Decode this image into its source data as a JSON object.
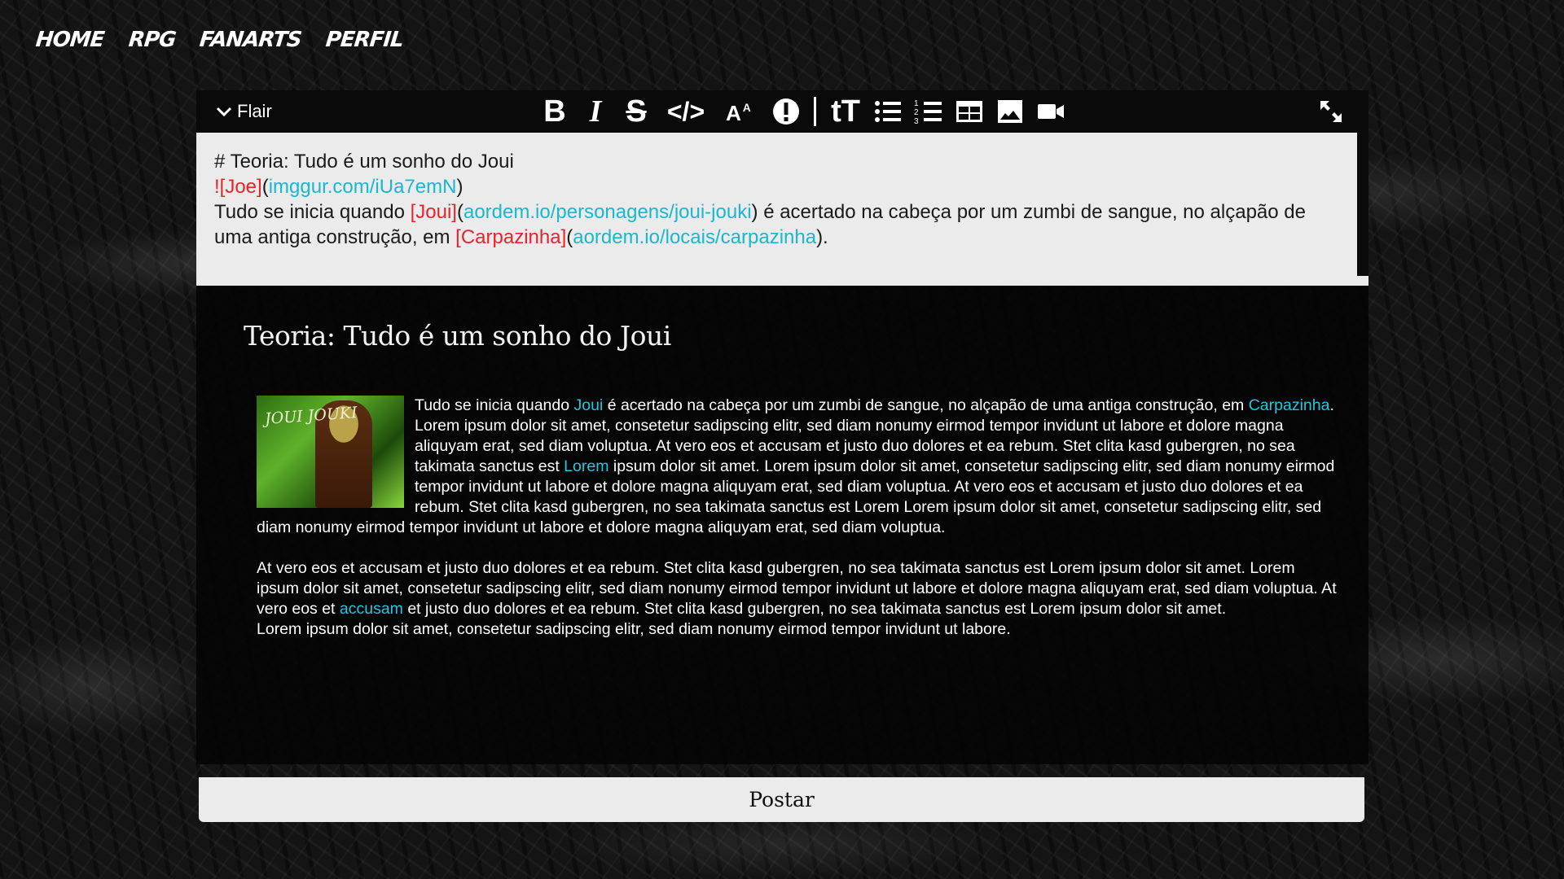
{
  "nav": {
    "home": "HOME",
    "rpg": "RPG",
    "fanarts": "FANARTS",
    "perfil": "PERFIL"
  },
  "toolbar": {
    "flair_label": "Flair",
    "bold": "B",
    "italic": "I",
    "strikethrough": "S",
    "code": "</>",
    "superscript": "AA",
    "spoiler": "!",
    "heading": "tT",
    "icons": [
      "chevron-down-icon",
      "bold-icon",
      "italic-icon",
      "strikethrough-icon",
      "code-icon",
      "superscript-icon",
      "spoiler-icon",
      "heading-icon",
      "bulleted-list-icon",
      "numbered-list-icon",
      "table-icon",
      "image-icon",
      "video-icon",
      "expand-icon"
    ]
  },
  "source": {
    "line1": "# Teoria: Tudo é um sonho do Joui",
    "img_alt": "![Joe]",
    "img_paren_open": "(",
    "img_url": "imggur.com/iUa7emN",
    "img_paren_close": ")",
    "p_start": "Tudo se inicia quando ",
    "joui_link": "[Joui]",
    "joui_paren_open": "(",
    "joui_url": "aordem.io/personagens/joui-jouki",
    "p_mid": ") é acertado na cabeça por um zumbi de sangue, no alçapão de uma antiga construção, em ",
    "carp_link": "[Carpazinha]",
    "carp_paren_open": "(",
    "carp_url": "aordem.io/locais/carpazinha",
    "p_end": ")."
  },
  "preview": {
    "title": "Teoria: Tudo é um sonho do Joui",
    "image_caption": "JOUI JOUKI",
    "p1_a": "Tudo se inicia quando ",
    "p1_link1": "Joui",
    "p1_b": " é acertado na cabeça por um zumbi de sangue, no alçapão de uma antiga construção, em ",
    "p1_link2": "Carpazinha",
    "p1_c": ". Lorem ipsum dolor sit amet, consetetur sadipscing elitr, sed diam nonumy eirmod tempor invidunt ut labore et dolore magna aliquyam erat, sed diam voluptua. At vero eos et accusam et justo duo dolores et ea rebum. Stet clita kasd gubergren, no sea takimata sanctus est ",
    "p1_link3": "Lorem",
    "p1_d": " ipsum dolor sit amet. Lorem ipsum dolor sit amet, consetetur sadipscing elitr, sed diam nonumy eirmod tempor invidunt ut labore et dolore magna aliquyam erat, sed diam voluptua. At vero eos et accusam et justo duo dolores et ea rebum. Stet clita kasd gubergren, no sea takimata sanctus est Lorem Lorem ipsum dolor sit amet, consetetur sadipscing elitr, sed diam nonumy eirmod tempor invidunt ut labore et dolore magna aliquyam erat, sed diam voluptua.",
    "p2_a": "At vero eos et accusam et justo duo dolores et ea rebum. Stet clita kasd gubergren, no sea takimata sanctus est Lorem ipsum dolor sit amet. Lorem ipsum dolor sit amet, consetetur sadipscing elitr, sed diam nonumy eirmod tempor invidunt ut labore et dolore magna aliquyam erat, sed diam voluptua. At vero eos et ",
    "p2_link": "accusam",
    "p2_b": " et justo duo dolores et ea rebum. Stet clita kasd gubergren, no sea takimata sanctus est Lorem ipsum dolor sit amet.",
    "p3": "Lorem ipsum dolor sit amet, consetetur sadipscing elitr, sed diam nonumy eirmod tempor invidunt ut labore."
  },
  "post_button": "Postar",
  "colors": {
    "link_red": "#e8232a",
    "link_cyan": "#19b7d0",
    "editor_bg": "#ebebeb",
    "toolbar_bg": "#0a0a0a"
  }
}
